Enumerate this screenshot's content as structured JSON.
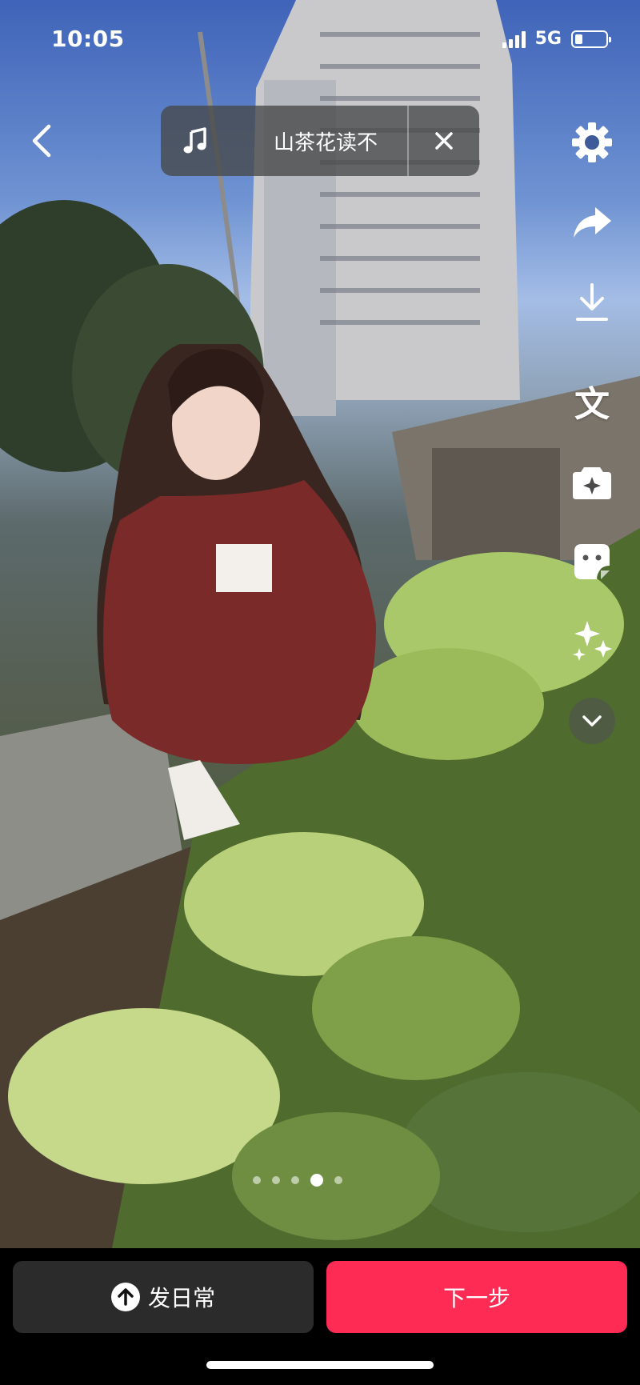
{
  "status_bar": {
    "time": "10:05",
    "network": "5G",
    "signal_bars": 4,
    "battery_level": 0.25
  },
  "header": {
    "back_icon": "chevron-left-icon",
    "music": {
      "note_icon": "music-note-icon",
      "title": "山茶花读不",
      "close_icon": "close-icon"
    }
  },
  "right_rail": {
    "settings_icon": "gear-icon",
    "share_icon": "share-arrow-icon",
    "download_icon": "download-icon",
    "text_glyph": "文",
    "sticker_icon": "camera-sparkle-icon",
    "effect_icon": "face-effect-icon",
    "enhance_icon": "sparkles-icon",
    "more_icon": "chevron-down-icon"
  },
  "carousel": {
    "page_count": 5,
    "current_page": 4
  },
  "bottom_bar": {
    "daily_label": "发日常",
    "next_label": "下一步",
    "next_color": "#fe2c55"
  }
}
